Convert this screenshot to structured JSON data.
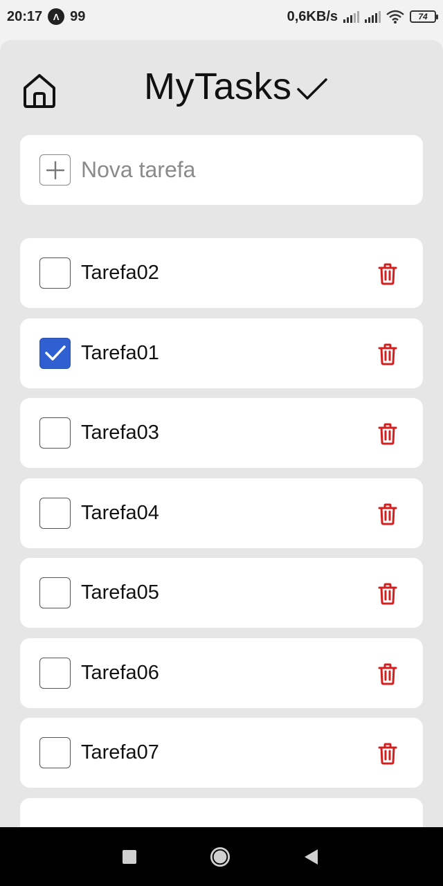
{
  "status_bar": {
    "time": "20:17",
    "notification_count": "99",
    "network_speed": "0,6KB/s",
    "battery_level": "74",
    "icons": [
      "app-notification-icon",
      "signal-icon",
      "signal-icon",
      "wifi-icon",
      "battery-icon"
    ]
  },
  "header": {
    "title": "MyTasks",
    "home_icon": "home-icon",
    "title_icon": "checkmark-icon"
  },
  "new_task": {
    "placeholder": "Nova tarefa",
    "value": "",
    "icon": "plus-icon"
  },
  "tasks": [
    {
      "label": "Tarefa02",
      "checked": false
    },
    {
      "label": "Tarefa01",
      "checked": true
    },
    {
      "label": "Tarefa03",
      "checked": false
    },
    {
      "label": "Tarefa04",
      "checked": false
    },
    {
      "label": "Tarefa05",
      "checked": false
    },
    {
      "label": "Tarefa06",
      "checked": false
    },
    {
      "label": "Tarefa07",
      "checked": false
    }
  ],
  "colors": {
    "accent": "#2f5fd0",
    "delete": "#d21f1f",
    "background": "#e6e6e6",
    "card": "#ffffff"
  },
  "nav_bar": {
    "icons": [
      "recents-icon",
      "home-circle-icon",
      "back-icon"
    ]
  }
}
